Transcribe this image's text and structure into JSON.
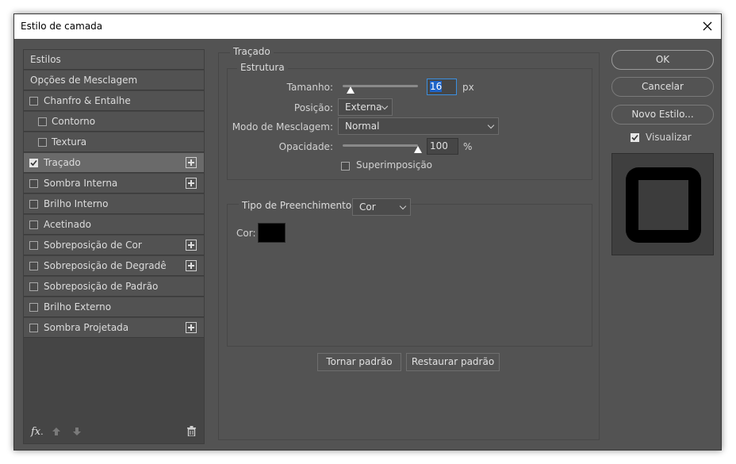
{
  "window": {
    "title": "Estilo de camada"
  },
  "sidebar": {
    "header1": "Estilos",
    "header2": "Opções de Mesclagem",
    "items": [
      {
        "label": "Chanfro & Entalhe",
        "checked": false,
        "has_plus": false
      },
      {
        "label": "Contorno",
        "checked": false,
        "has_plus": false
      },
      {
        "label": "Textura",
        "checked": false,
        "has_plus": false
      },
      {
        "label": "Traçado",
        "checked": true,
        "has_plus": true
      },
      {
        "label": "Sombra Interna",
        "checked": false,
        "has_plus": true
      },
      {
        "label": "Brilho Interno",
        "checked": false,
        "has_plus": false
      },
      {
        "label": "Acetinado",
        "checked": false,
        "has_plus": false
      },
      {
        "label": "Sobreposição de Cor",
        "checked": false,
        "has_plus": true
      },
      {
        "label": "Sobreposição de Degradê",
        "checked": false,
        "has_plus": true
      },
      {
        "label": "Sobreposição de Padrão",
        "checked": false,
        "has_plus": false
      },
      {
        "label": "Brilho Externo",
        "checked": false,
        "has_plus": false
      },
      {
        "label": "Sombra Projetada",
        "checked": false,
        "has_plus": true
      }
    ],
    "footer": {
      "fx_label": "fx",
      "fx_suffix": "."
    }
  },
  "stroke": {
    "section_title": "Traçado",
    "structure_title": "Estrutura",
    "size_label": "Tamanho:",
    "size_value": "16",
    "size_unit": "px",
    "size_slider_fraction": 0.1,
    "position_label": "Posição:",
    "position_value": "Externa",
    "blend_label": "Modo de Mesclagem:",
    "blend_value": "Normal",
    "opacity_label": "Opacidade:",
    "opacity_value": "100",
    "opacity_unit": "%",
    "opacity_slider_fraction": 1.0,
    "overprint_label": "Superimposição",
    "overprint_checked": false,
    "fill_type_label": "Tipo de Preenchimento:",
    "fill_type_value": "Cor",
    "color_label": "Cor:",
    "color_value": "#000000",
    "make_default": "Tornar padrão",
    "reset_default": "Restaurar padrão"
  },
  "actions": {
    "ok": "OK",
    "cancel": "Cancelar",
    "new_style": "Novo Estilo...",
    "preview_label": "Visualizar",
    "preview_checked": true
  },
  "colors": {
    "dialog_bg": "#535353",
    "selected_row": "#6a6a6a",
    "focus": "#3b8fe0"
  }
}
